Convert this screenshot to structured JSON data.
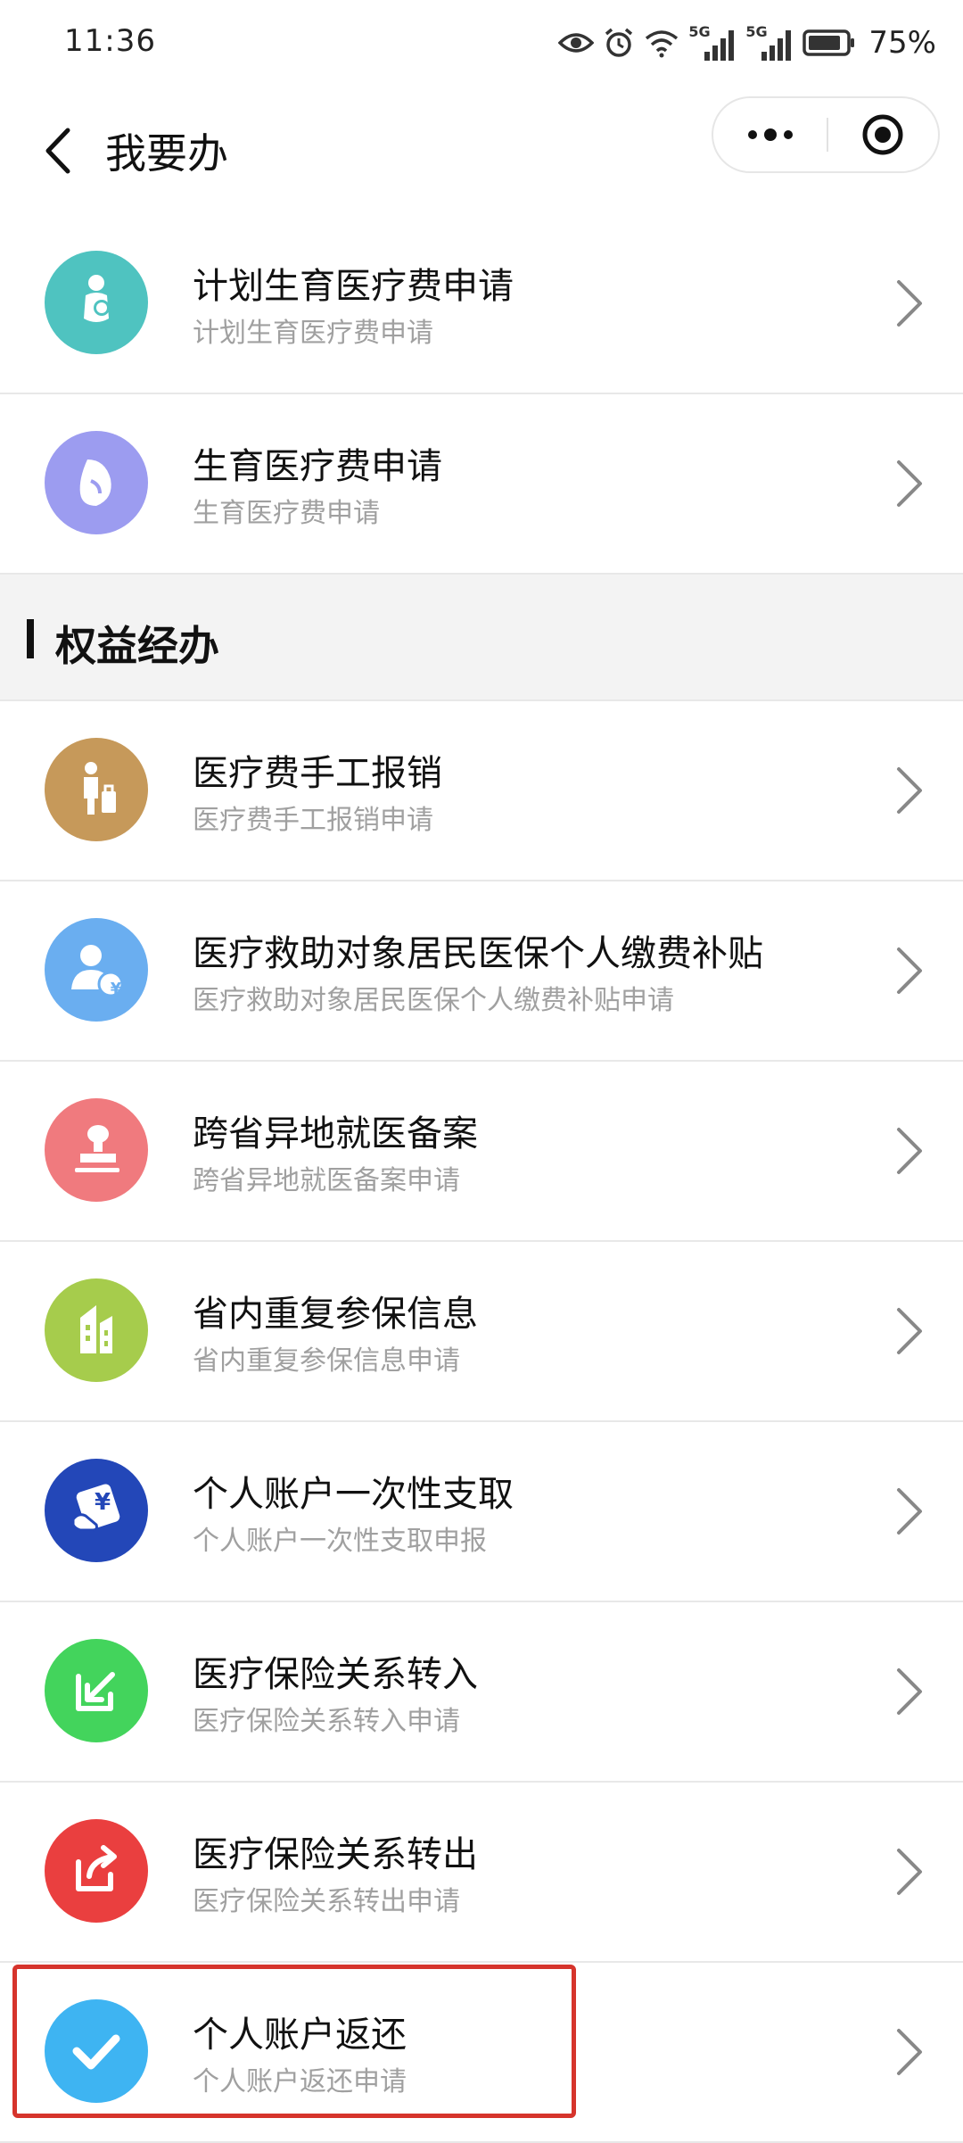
{
  "status_bar": {
    "time": "11:36",
    "network_1": "5G",
    "network_2": "5G",
    "battery": "75%"
  },
  "nav": {
    "title": "我要办"
  },
  "section_1": {
    "items": [
      {
        "title": "计划生育医疗费申请",
        "subtitle": "计划生育医疗费申请",
        "icon": "pregnant-woman-icon",
        "color": "#4fc3c0"
      },
      {
        "title": "生育医疗费申请",
        "subtitle": "生育医疗费申请",
        "icon": "pregnant-belly-icon",
        "color": "#9c9cf0"
      }
    ]
  },
  "section_2": {
    "title": "权益经办",
    "items": [
      {
        "title": "医疗费手工报销",
        "subtitle": "医疗费手工报销申请",
        "icon": "traveler-luggage-icon",
        "color": "#c6995a"
      },
      {
        "title": "医疗救助对象居民医保个人缴费补贴",
        "subtitle": "医疗救助对象居民医保个人缴费补贴申请",
        "icon": "person-yuan-icon",
        "color": "#6aaef0",
        "badge": "¥"
      },
      {
        "title": "跨省异地就医备案",
        "subtitle": "跨省异地就医备案申请",
        "icon": "stamp-icon",
        "color": "#f07a7e"
      },
      {
        "title": "省内重复参保信息",
        "subtitle": "省内重复参保信息申请",
        "icon": "buildings-icon",
        "color": "#a6cc4c"
      },
      {
        "title": "个人账户一次性支取",
        "subtitle": "个人账户一次性支取申报",
        "icon": "hand-card-icon",
        "color": "#2347b8",
        "badge": "¥"
      },
      {
        "title": "医疗保险关系转入",
        "subtitle": "医疗保险关系转入申请",
        "icon": "transfer-in-icon",
        "color": "#43d45c"
      },
      {
        "title": "医疗保险关系转出",
        "subtitle": "医疗保险关系转出申请",
        "icon": "transfer-out-icon",
        "color": "#ea3f3f"
      },
      {
        "title": "个人账户返还",
        "subtitle": "个人账户返还申请",
        "icon": "checkmark-icon",
        "color": "#3eb4f2"
      }
    ]
  },
  "colors": {
    "highlight_border": "#d6342c",
    "section_bg": "#f3f3f3",
    "subtitle_text": "#a0a0a0"
  }
}
